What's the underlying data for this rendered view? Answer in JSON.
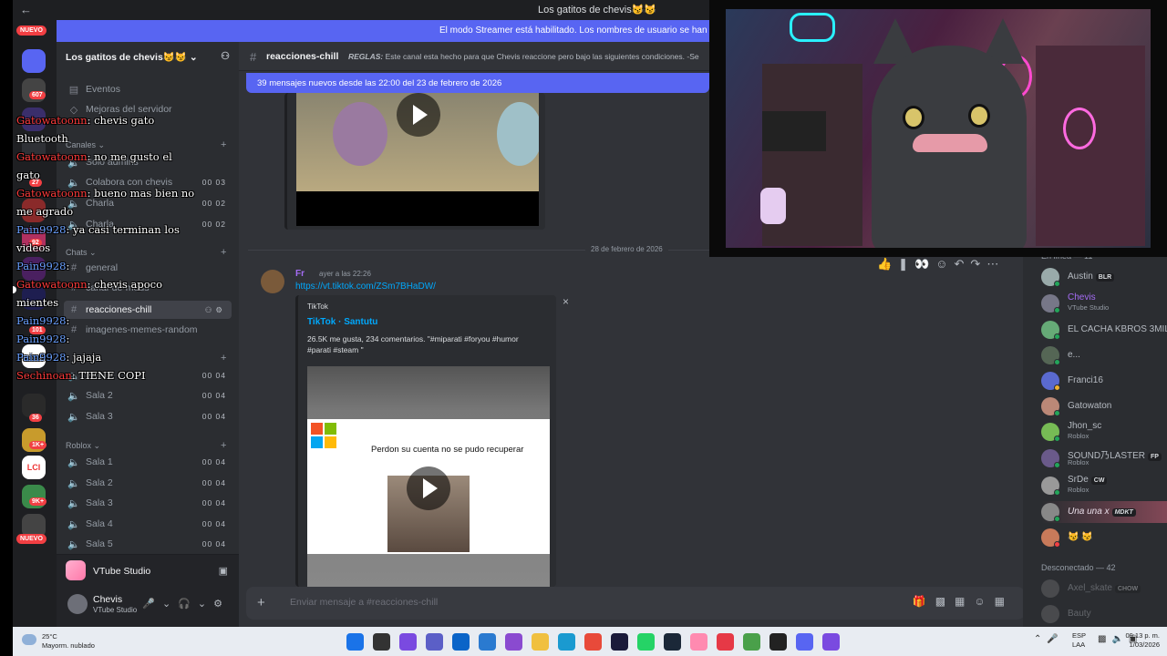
{
  "window": {
    "title": "Los gatitos de chevis😼😼",
    "back_glyph": "←"
  },
  "streamer_banner": "El modo Streamer está habilitado. Los nombres de usuario se han truncado",
  "servers": {
    "badges": [
      {
        "label": "NUEVO"
      },
      {
        "label": "607"
      },
      {
        "label": "27"
      },
      {
        "label": "92"
      },
      {
        "label": "101"
      },
      {
        "label": "36"
      },
      {
        "label": "1K+"
      },
      {
        "label": "9K+"
      },
      {
        "label": "NUEVO"
      }
    ]
  },
  "guild": {
    "name": "Los gatitos de chevis😼😼",
    "chevron": "⌄"
  },
  "channels": {
    "events": "Eventos",
    "boosts": "Mejoras del servidor",
    "cat_canales": "Canales",
    "solo_admins": "Solo admins",
    "colabora": {
      "label": "Colabora con chevis",
      "count": "00 03"
    },
    "charla1": {
      "label": "Charla",
      "count": "00 02"
    },
    "charla2": {
      "label": "Charla",
      "count": "00 02"
    },
    "cat_chats": "Chats",
    "general": "general",
    "canal_mods": "canal-de-mods",
    "reacciones": "reacciones-chill",
    "imagenes": "imagenes-memes-random",
    "sala1a": {
      "label": "Sala 1",
      "count": "00 04"
    },
    "sala2a": {
      "label": "Sala 2",
      "count": "00 04"
    },
    "sala3a": {
      "label": "Sala 3",
      "count": "00 04"
    },
    "cat_roblox": "Roblox",
    "sala1b": {
      "label": "Sala 1",
      "count": "00 04"
    },
    "sala2b": {
      "label": "Sala 2",
      "count": "00 04"
    },
    "sala3b": {
      "label": "Sala 3",
      "count": "00 04"
    },
    "sala4b": {
      "label": "Sala 4",
      "count": "00 04"
    },
    "sala5b": {
      "label": "Sala 5",
      "count": "00 04"
    }
  },
  "activity_panel": {
    "label": "VTube Studio"
  },
  "user": {
    "name": "Chevis",
    "status": "VTube Studio"
  },
  "chat": {
    "channel": "reacciones-chill",
    "topic_prefix": "REGLAS:",
    "topic": "Este canal esta hecho para que Chevis reaccione pero bajo las siguientes condiciones. -Se",
    "new_messages": "39 mensajes nuevos desde las 22:00 del 23 de febrero de 2026",
    "date_divider": "28 de febrero de 2026",
    "message": {
      "author": "Fr",
      "time": "ayer a las 22:26",
      "link": "https://vt.tiktok.com/ZSm7BHaDW/",
      "embed_provider": "TikTok",
      "embed_title": "TikTok · Santutu",
      "embed_desc": "26.5K me gusta, 234 comentarios. \"#miparati #foryou #humor #parati #steam \"",
      "video_caption": "Perdon su cuenta no se pudo recuperar"
    },
    "composer_placeholder": "Enviar mensaje a #reacciones-chill"
  },
  "members": {
    "online_header": "En línea — 11",
    "offline_header": "Desconectado — 42",
    "list": [
      {
        "name": "Austin",
        "tag": "BLR",
        "sub": ""
      },
      {
        "name": "Chevis",
        "tag": "",
        "sub": "VTube Studio"
      },
      {
        "name": "EL CACHA KBROS 3MIL",
        "tag": "",
        "sub": ""
      },
      {
        "name": "e...",
        "tag": "",
        "sub": ""
      },
      {
        "name": "Franci16",
        "tag": "",
        "sub": ""
      },
      {
        "name": "Gatowaton",
        "tag": "",
        "sub": ""
      },
      {
        "name": "Jhon_sc",
        "tag": "",
        "sub": "Roblox"
      },
      {
        "name": "SOUND乃LASTER",
        "tag": "FP",
        "sub": "Roblox"
      },
      {
        "name": "SrDe",
        "tag": "CW",
        "sub": "Roblox"
      },
      {
        "name": "Una una x",
        "tag": "MDKT",
        "sub": ""
      },
      {
        "name": "😼 😼",
        "tag": "",
        "sub": ""
      }
    ],
    "offline": [
      {
        "name": "Axel_skate",
        "tag": "CHOW"
      },
      {
        "name": "Bauty",
        "tag": ""
      }
    ]
  },
  "overlay_chat": [
    {
      "user": "Gatowatoonn",
      "text": ": chevis gato Bluetooth",
      "blue": false
    },
    {
      "user": "Gatowatoonn",
      "text": ": no me gusto el gato",
      "blue": false
    },
    {
      "user": "Gatowatoonn",
      "text": ": bueno mas bien no me agrado",
      "blue": false
    },
    {
      "user": "Pain9928",
      "text": ": ya casi terminan los videos",
      "blue": true
    },
    {
      "user": "Pain9928",
      "text": ": ",
      "blue": true
    },
    {
      "user": "Gatowatoonn",
      "text": ": chevis apoco mientes",
      "blue": false
    },
    {
      "user": "Pain9928",
      "text": ": ",
      "blue": true
    },
    {
      "user": "Pain9928",
      "text": ": ",
      "blue": true
    },
    {
      "user": "Pain9928",
      "text": ": jajaja",
      "blue": true
    },
    {
      "user": "Sechinoan",
      "text": ": TIENE COPI",
      "blue": false
    }
  ],
  "taskbar": {
    "weather_temp": "25°C",
    "weather_desc": "Mayorm. nublado",
    "lang1": "ESP",
    "lang2": "LAA",
    "time": "09:13 p. m.",
    "date": "1/03/2026"
  },
  "colors": {
    "blurple": "#5865f2",
    "link": "#00a8fc",
    "online": "#23a55a",
    "bg": "#313338"
  }
}
